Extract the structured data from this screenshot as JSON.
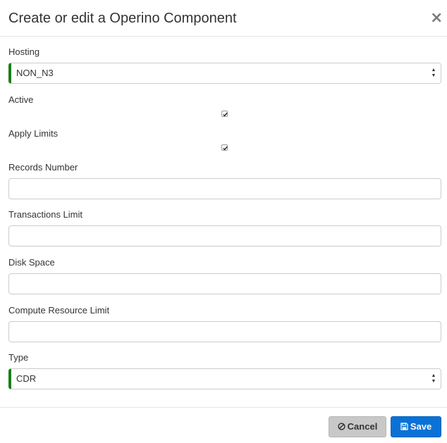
{
  "modal": {
    "title": "Create or edit a Operino Component",
    "close_symbol": "×"
  },
  "form": {
    "hosting": {
      "label": "Hosting",
      "value": "NON_N3"
    },
    "active": {
      "label": "Active",
      "checked": true
    },
    "apply_limits": {
      "label": "Apply Limits",
      "checked": true
    },
    "records_number": {
      "label": "Records Number",
      "value": ""
    },
    "transactions_limit": {
      "label": "Transactions Limit",
      "value": ""
    },
    "disk_space": {
      "label": "Disk Space",
      "value": ""
    },
    "compute_resource_limit": {
      "label": "Compute Resource Limit",
      "value": ""
    },
    "type": {
      "label": "Type",
      "value": "CDR"
    }
  },
  "footer": {
    "cancel_label": "Cancel",
    "save_label": "Save"
  },
  "icons": {
    "cancel": "ban-icon",
    "save": "floppy-disk-icon",
    "close": "close-icon",
    "select_arrows": "up-down-arrows-icon",
    "checkmark": "checkmark-icon"
  },
  "colors": {
    "primary": "#0a72d6",
    "select_accent": "#1a7f1a",
    "cancel_bg": "#c8c8c8"
  }
}
